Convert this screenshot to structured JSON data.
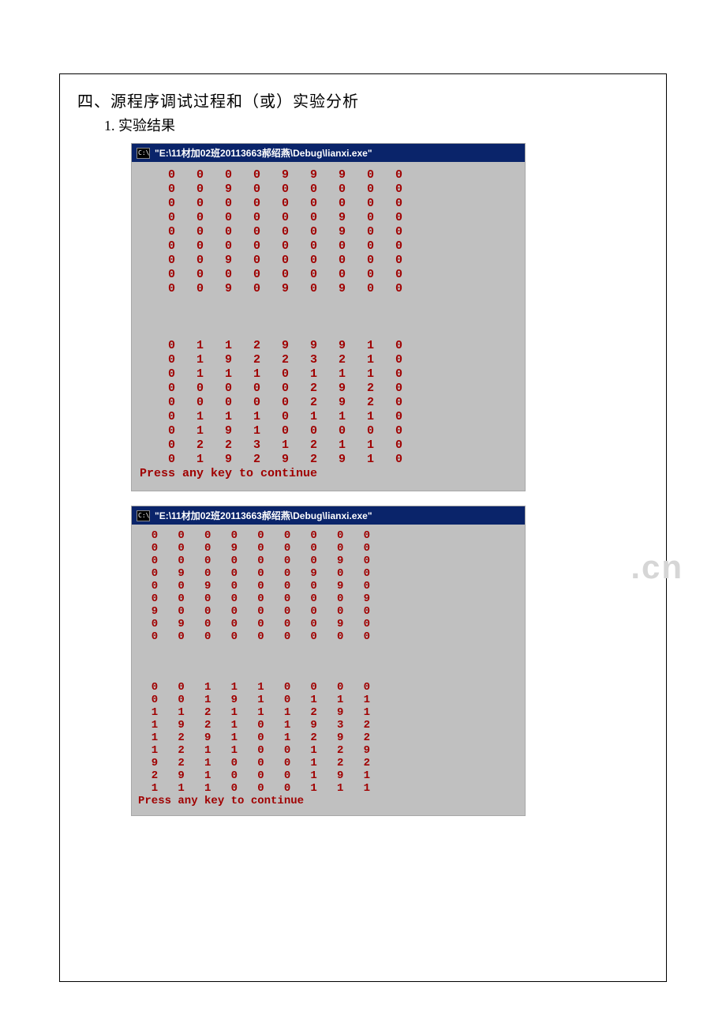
{
  "heading": "四、源程序调试过程和（或）实验分析",
  "subheading": "1. 实验结果",
  "watermark": ".cn",
  "console1": {
    "icon_label": "C:\\",
    "title": "\"E:\\11材加02班20113663郝绍燕\\Debug\\lianxi.exe\"",
    "block_a": [
      "    0   0   0   0   9   9   9   0   0",
      "    0   0   9   0   0   0   0   0   0",
      "    0   0   0   0   0   0   0   0   0",
      "    0   0   0   0   0   0   9   0   0",
      "    0   0   0   0   0   0   9   0   0",
      "    0   0   0   0   0   0   0   0   0",
      "    0   0   9   0   0   0   0   0   0",
      "    0   0   0   0   0   0   0   0   0",
      "    0   0   9   0   9   0   9   0   0"
    ],
    "block_b": [
      "    0   1   1   2   9   9   9   1   0",
      "    0   1   9   2   2   3   2   1   0",
      "    0   1   1   1   0   1   1   1   0",
      "    0   0   0   0   0   2   9   2   0",
      "    0   0   0   0   0   2   9   2   0",
      "    0   1   1   1   0   1   1   1   0",
      "    0   1   9   1   0   0   0   0   0",
      "    0   2   2   3   1   2   1   1   0",
      "    0   1   9   2   9   2   9   1   0"
    ],
    "footer": "Press any key to continue"
  },
  "console2": {
    "icon_label": "C:\\",
    "title": "\"E:\\11材加02班20113663郝绍燕\\Debug\\lianxi.exe\"",
    "block_a": [
      "  0   0   0   0   0   0   0   0   0",
      "  0   0   0   9   0   0   0   0   0",
      "  0   0   0   0   0   0   0   9   0",
      "  0   9   0   0   0   0   9   0   0",
      "  0   0   9   0   0   0   0   9   0",
      "  0   0   0   0   0   0   0   0   9",
      "  9   0   0   0   0   0   0   0   0",
      "  0   9   0   0   0   0   0   9   0",
      "  0   0   0   0   0   0   0   0   0"
    ],
    "block_b": [
      "  0   0   1   1   1   0   0   0   0",
      "  0   0   1   9   1   0   1   1   1",
      "  1   1   2   1   1   1   2   9   1",
      "  1   9   2   1   0   1   9   3   2",
      "  1   2   9   1   0   1   2   9   2",
      "  1   2   1   1   0   0   1   2   9",
      "  9   2   1   0   0   0   1   2   2",
      "  2   9   1   0   0   0   1   9   1",
      "  1   1   1   0   0   0   1   1   1"
    ],
    "footer": "Press any key to continue"
  },
  "chart_data": {
    "type": "table",
    "note": "Two console outputs, each containing two 9x9 integer grids (representing a minesweeper-like matrix before and after calculation).",
    "console1_grid_input": [
      [
        0,
        0,
        0,
        0,
        9,
        9,
        9,
        0,
        0
      ],
      [
        0,
        0,
        9,
        0,
        0,
        0,
        0,
        0,
        0
      ],
      [
        0,
        0,
        0,
        0,
        0,
        0,
        0,
        0,
        0
      ],
      [
        0,
        0,
        0,
        0,
        0,
        0,
        9,
        0,
        0
      ],
      [
        0,
        0,
        0,
        0,
        0,
        0,
        9,
        0,
        0
      ],
      [
        0,
        0,
        0,
        0,
        0,
        0,
        0,
        0,
        0
      ],
      [
        0,
        0,
        9,
        0,
        0,
        0,
        0,
        0,
        0
      ],
      [
        0,
        0,
        0,
        0,
        0,
        0,
        0,
        0,
        0
      ],
      [
        0,
        0,
        9,
        0,
        9,
        0,
        9,
        0,
        0
      ]
    ],
    "console1_grid_output": [
      [
        0,
        1,
        1,
        2,
        9,
        9,
        9,
        1,
        0
      ],
      [
        0,
        1,
        9,
        2,
        2,
        3,
        2,
        1,
        0
      ],
      [
        0,
        1,
        1,
        1,
        0,
        1,
        1,
        1,
        0
      ],
      [
        0,
        0,
        0,
        0,
        0,
        2,
        9,
        2,
        0
      ],
      [
        0,
        0,
        0,
        0,
        0,
        2,
        9,
        2,
        0
      ],
      [
        0,
        1,
        1,
        1,
        0,
        1,
        1,
        1,
        0
      ],
      [
        0,
        1,
        9,
        1,
        0,
        0,
        0,
        0,
        0
      ],
      [
        0,
        2,
        2,
        3,
        1,
        2,
        1,
        1,
        0
      ],
      [
        0,
        1,
        9,
        2,
        9,
        2,
        9,
        1,
        0
      ]
    ],
    "console2_grid_input": [
      [
        0,
        0,
        0,
        0,
        0,
        0,
        0,
        0,
        0
      ],
      [
        0,
        0,
        0,
        9,
        0,
        0,
        0,
        0,
        0
      ],
      [
        0,
        0,
        0,
        0,
        0,
        0,
        0,
        9,
        0
      ],
      [
        0,
        9,
        0,
        0,
        0,
        0,
        9,
        0,
        0
      ],
      [
        0,
        0,
        9,
        0,
        0,
        0,
        0,
        9,
        0
      ],
      [
        0,
        0,
        0,
        0,
        0,
        0,
        0,
        0,
        9
      ],
      [
        9,
        0,
        0,
        0,
        0,
        0,
        0,
        0,
        0
      ],
      [
        0,
        9,
        0,
        0,
        0,
        0,
        0,
        9,
        0
      ],
      [
        0,
        0,
        0,
        0,
        0,
        0,
        0,
        0,
        0
      ]
    ],
    "console2_grid_output": [
      [
        0,
        0,
        1,
        1,
        1,
        0,
        0,
        0,
        0
      ],
      [
        0,
        0,
        1,
        9,
        1,
        0,
        1,
        1,
        1
      ],
      [
        1,
        1,
        2,
        1,
        1,
        1,
        2,
        9,
        1
      ],
      [
        1,
        9,
        2,
        1,
        0,
        1,
        9,
        3,
        2
      ],
      [
        1,
        2,
        9,
        1,
        0,
        1,
        2,
        9,
        2
      ],
      [
        1,
        2,
        1,
        1,
        0,
        0,
        1,
        2,
        9
      ],
      [
        9,
        2,
        1,
        0,
        0,
        0,
        1,
        2,
        2
      ],
      [
        2,
        9,
        1,
        0,
        0,
        0,
        1,
        9,
        1
      ],
      [
        1,
        1,
        1,
        0,
        0,
        0,
        1,
        1,
        1
      ]
    ]
  }
}
